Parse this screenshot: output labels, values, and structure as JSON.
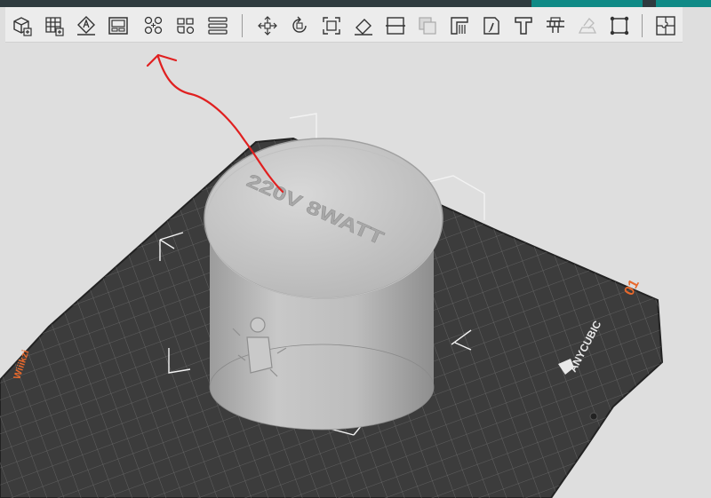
{
  "window": {
    "accent_color": "#0f8a86"
  },
  "toolbar": {
    "group1": [
      {
        "id": "add-object",
        "icon": "cube-add-icon"
      },
      {
        "id": "add-plate",
        "icon": "grid-add-icon"
      },
      {
        "id": "auto-orient",
        "icon": "orient-icon"
      },
      {
        "id": "arrange-plates",
        "icon": "plates-icon"
      }
    ],
    "group2": [
      {
        "id": "arrange",
        "icon": "arrange-icon"
      },
      {
        "id": "split-parts",
        "icon": "split-parts-icon"
      },
      {
        "id": "layers",
        "icon": "layers-icon"
      }
    ],
    "group3": [
      {
        "id": "move",
        "icon": "move-icon"
      },
      {
        "id": "rotate",
        "icon": "rotate-icon"
      },
      {
        "id": "scale",
        "icon": "scale-icon"
      },
      {
        "id": "lay-on-face",
        "icon": "lay-on-face-icon"
      },
      {
        "id": "cut",
        "icon": "cut-icon"
      },
      {
        "id": "boolean",
        "icon": "boolean-icon"
      },
      {
        "id": "paint-support",
        "icon": "paint-support-icon"
      },
      {
        "id": "seam-paint",
        "icon": "seam-paint-icon"
      },
      {
        "id": "text",
        "icon": "text-icon"
      },
      {
        "id": "measure",
        "icon": "measure-icon"
      },
      {
        "id": "assemble",
        "icon": "assemble-icon"
      },
      {
        "id": "hollow",
        "icon": "hollow-icon"
      }
    ],
    "group4": [
      {
        "id": "variable-layer",
        "icon": "puzzle-icon"
      }
    ]
  },
  "viewport": {
    "plate_brand": "ANYCUBIC",
    "plate_number": "01",
    "plate_side_label": "Wiiikzi",
    "model_emboss_text": "220V 8WATT",
    "annotation_color": "#e02020"
  }
}
